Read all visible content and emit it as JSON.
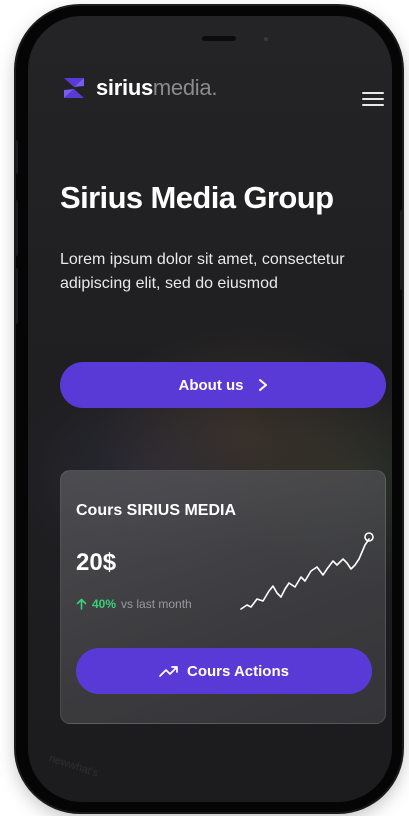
{
  "brand": {
    "name_bold": "sirius",
    "name_light": "media.",
    "accent_color": "#5a3ad6"
  },
  "header": {
    "menu_icon": "hamburger-menu-icon"
  },
  "hero": {
    "title": "Sirius Media Group",
    "description": "Lorem ipsum dolor sit amet, consectetur adipiscing elit, sed do eiusmod",
    "cta_label": "About us",
    "cta_icon": "chevron-right-icon"
  },
  "card": {
    "title": "Cours SIRIUS MEDIA",
    "price": "20$",
    "change_percent": "40%",
    "change_direction": "up",
    "change_color": "#39d07a",
    "change_label": "vs last month",
    "action_label": "Cours Actions",
    "action_icon": "trending-up-icon"
  },
  "watermark": "newwhat's"
}
